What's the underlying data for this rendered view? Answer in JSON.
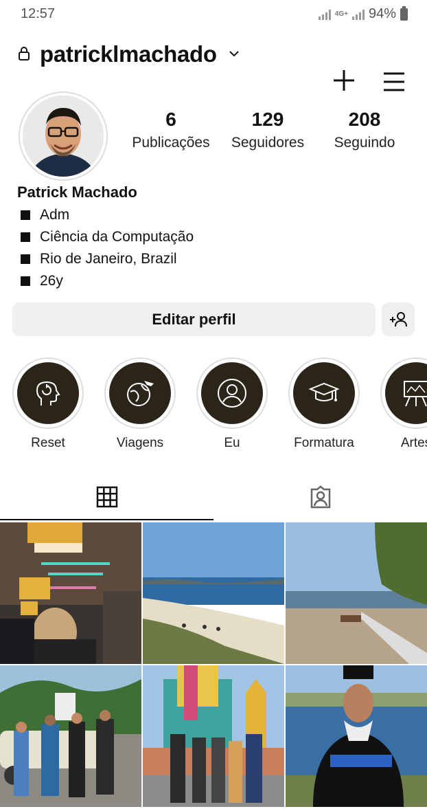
{
  "status_bar": {
    "time": "12:57",
    "network": "4G+",
    "battery": "94%"
  },
  "header": {
    "username": "patricklmachado"
  },
  "profile": {
    "display_name": "Patrick Machado",
    "stats": [
      {
        "value": "6",
        "label": "Publicações"
      },
      {
        "value": "129",
        "label": "Seguidores"
      },
      {
        "value": "208",
        "label": "Seguindo"
      }
    ],
    "bio": [
      "Adm",
      "Ciência da Computação",
      "Rio de Janeiro, Brazil",
      "26y"
    ]
  },
  "actions": {
    "edit_profile": "Editar perfil"
  },
  "highlights": [
    {
      "label": "Reset",
      "icon": "head-reset-icon"
    },
    {
      "label": "Viagens",
      "icon": "globe-plane-icon"
    },
    {
      "label": "Eu",
      "icon": "user-circle-icon"
    },
    {
      "label": "Formatura",
      "icon": "graduation-cap-icon"
    },
    {
      "label": "Artes",
      "icon": "easel-icon"
    }
  ],
  "tabs": [
    {
      "name": "posts-grid",
      "icon": "grid-icon",
      "active": true
    },
    {
      "name": "tagged",
      "icon": "tagged-person-icon",
      "active": false
    }
  ],
  "colors": {
    "highlight_bg": "#2b2519",
    "button_bg": "#efefef",
    "accent": "#111111"
  }
}
